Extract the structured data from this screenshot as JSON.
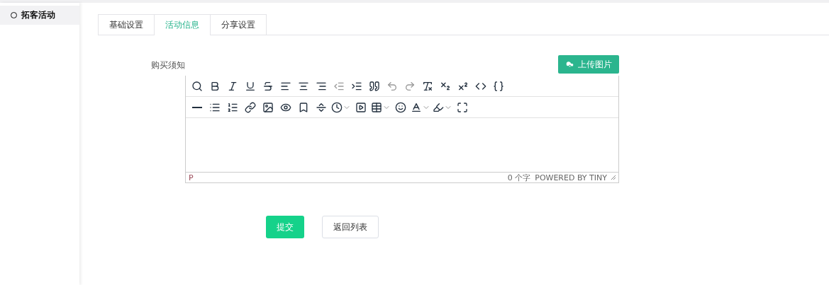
{
  "sidebar": {
    "items": [
      {
        "label": "拓客活动",
        "selected": true
      }
    ]
  },
  "tabs": [
    {
      "label": "基础设置",
      "selected": false
    },
    {
      "label": "活动信息",
      "selected": true
    },
    {
      "label": "分享设置",
      "selected": false
    }
  ],
  "form": {
    "label": "购买须知",
    "upload_button": "上传图片"
  },
  "editor": {
    "toolbar_rows": [
      [
        {
          "kind": "search",
          "disabled": false
        },
        {
          "kind": "bold",
          "disabled": false
        },
        {
          "kind": "italic",
          "disabled": false
        },
        {
          "kind": "underline",
          "disabled": false
        },
        {
          "kind": "strikethrough",
          "disabled": false
        },
        {
          "kind": "align-left",
          "disabled": false
        },
        {
          "kind": "align-center",
          "disabled": false
        },
        {
          "kind": "align-right",
          "disabled": false
        },
        {
          "kind": "outdent",
          "disabled": true
        },
        {
          "kind": "indent",
          "disabled": false
        },
        {
          "kind": "quote",
          "disabled": false
        },
        {
          "kind": "undo",
          "disabled": true
        },
        {
          "kind": "redo",
          "disabled": true
        },
        {
          "kind": "clear-format",
          "disabled": false
        },
        {
          "kind": "subscript",
          "disabled": false
        },
        {
          "kind": "superscript",
          "disabled": false
        },
        {
          "kind": "code",
          "disabled": false
        },
        {
          "kind": "braces",
          "disabled": false
        }
      ],
      [
        {
          "kind": "rule",
          "disabled": false
        },
        {
          "kind": "bullet-list",
          "disabled": false
        },
        {
          "kind": "number-list",
          "disabled": false
        },
        {
          "kind": "link",
          "disabled": false
        },
        {
          "kind": "image",
          "disabled": false
        },
        {
          "kind": "preview",
          "disabled": false
        },
        {
          "kind": "bookmark",
          "disabled": false
        },
        {
          "kind": "page-break",
          "disabled": false
        },
        {
          "kind": "clock",
          "disabled": false,
          "dropdown": true
        },
        {
          "kind": "media",
          "disabled": false
        },
        {
          "kind": "table",
          "disabled": false,
          "dropdown": true
        },
        {
          "kind": "emoji",
          "disabled": false
        },
        {
          "kind": "text-color",
          "disabled": false,
          "dropdown": true
        },
        {
          "kind": "highlight",
          "disabled": false,
          "dropdown": true
        },
        {
          "kind": "fullscreen",
          "disabled": false
        }
      ]
    ],
    "path": "P",
    "word_count": "0 个字",
    "branding": "POWERED BY TINY"
  },
  "buttons": [
    {
      "label": "提交",
      "kind": "primary"
    },
    {
      "label": "返回列表",
      "kind": "default"
    }
  ]
}
